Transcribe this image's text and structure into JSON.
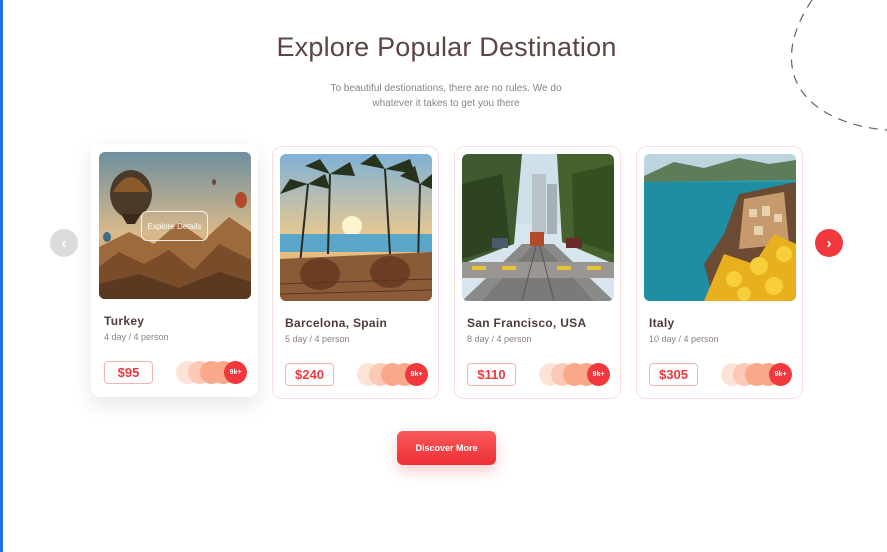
{
  "section": {
    "title": "Explore Popular Destination",
    "subtitle": "To beautiful destionations, there are no rules. We do whatever it takes to get you there"
  },
  "carousel": {
    "prev_icon": "chevron-left-icon",
    "next_icon": "chevron-right-icon",
    "prev_glyph": "‹",
    "next_glyph": "›"
  },
  "destinations": [
    {
      "name": "Turkey",
      "duration": "4 day / 4 person",
      "price": "$95",
      "travelers": "9k+",
      "overlay_label": "Explore Details",
      "active": true
    },
    {
      "name": "Barcelona, Spain",
      "duration": "5 day / 4 person",
      "price": "$240",
      "travelers": "9k+"
    },
    {
      "name": "San Francisco, USA",
      "duration": "8 day / 4 person",
      "price": "$110",
      "travelers": "9k+"
    },
    {
      "name": "Italy",
      "duration": "10 day / 4 person",
      "price": "$305",
      "travelers": "9k+"
    }
  ],
  "cta": {
    "label": "Discover More"
  },
  "colors": {
    "accent": "#f0383e",
    "title": "#5b4645",
    "avatar_1": "#fde2d8",
    "avatar_2": "#fcc9b6",
    "avatar_3": "#f9a98a"
  }
}
